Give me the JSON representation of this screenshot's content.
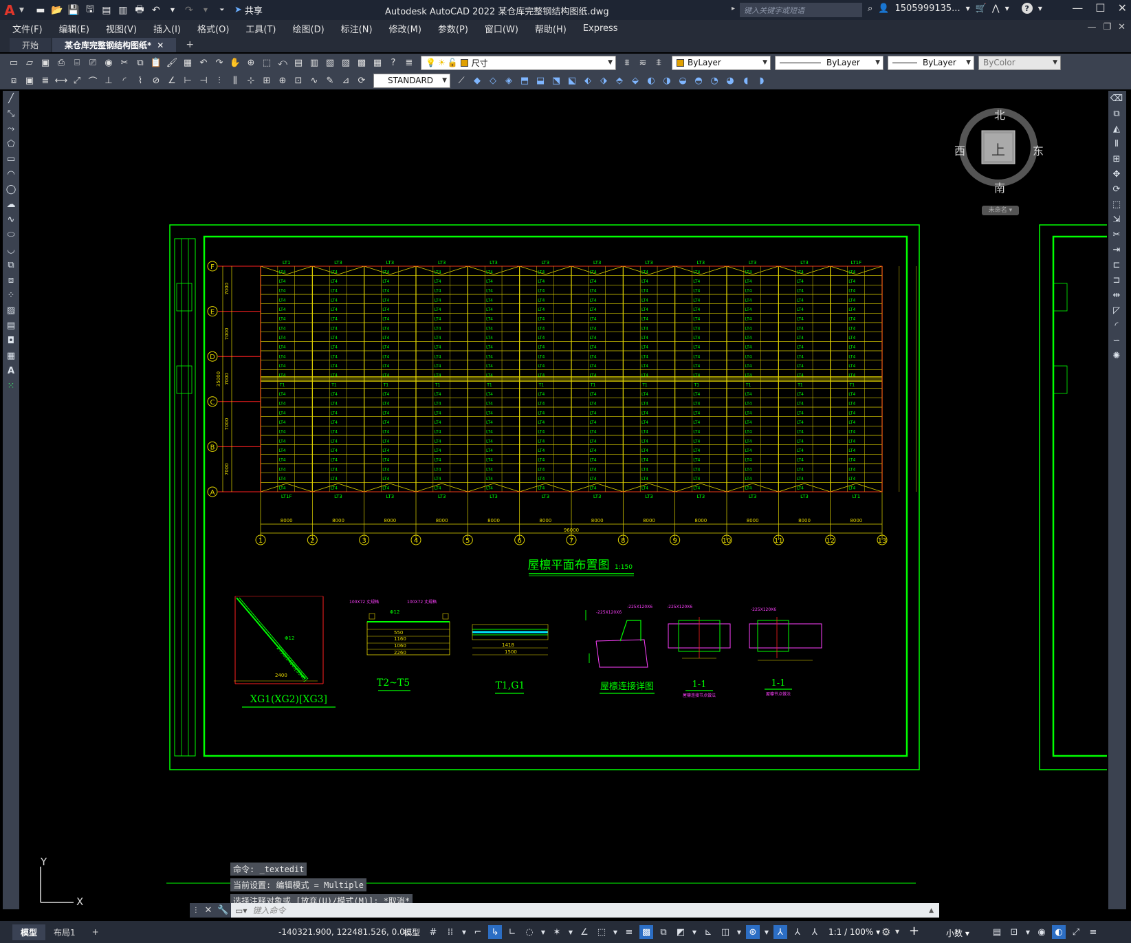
{
  "app": {
    "title": "Autodesk AutoCAD 2022    某仓库完整钢结构图纸.dwg",
    "logo": "A",
    "share_label": "共享",
    "search_placeholder": "键入关键字或短语",
    "user": "1505999135...",
    "help": "?"
  },
  "menu": [
    "文件(F)",
    "编辑(E)",
    "视图(V)",
    "插入(I)",
    "格式(O)",
    "工具(T)",
    "绘图(D)",
    "标注(N)",
    "修改(M)",
    "参数(P)",
    "窗口(W)",
    "帮助(H)",
    "Express"
  ],
  "tabs": [
    {
      "label": "开始",
      "active": false
    },
    {
      "label": "某仓库完整钢结构图纸*",
      "active": true
    }
  ],
  "toolbar": {
    "layer_name": "尺寸",
    "color_select": "ByLayer",
    "linetype_select": "ByLayer",
    "lineweight_select": "ByLayer",
    "plotstyle_select": "ByColor",
    "textstyle_select": "STANDARD"
  },
  "viewcube": {
    "north": "北",
    "south": "南",
    "east": "东",
    "west": "西",
    "face": "上",
    "ucs_menu": "未命名"
  },
  "drawing": {
    "plan_title": "屋檩平面布置图",
    "plan_scale": "1:150",
    "axis_numbers": [
      "1",
      "2",
      "3",
      "4",
      "5",
      "6",
      "7",
      "8",
      "9",
      "10",
      "11",
      "12",
      "13"
    ],
    "axis_letters": [
      "F",
      "E",
      "D",
      "C",
      "B",
      "A"
    ],
    "bay_dims": [
      "8000",
      "8000",
      "8000",
      "8000",
      "8000",
      "8000",
      "8000",
      "8000",
      "8000",
      "8000",
      "8000",
      "8000"
    ],
    "total_dim": "96000",
    "row_dims": [
      "7000",
      "7000",
      "7000",
      "7000",
      "7000"
    ],
    "total_height_dim": "35000",
    "top_labels": [
      "LT1",
      "LT3",
      "LT3",
      "LT3",
      "LT3",
      "LT3",
      "LT3",
      "LT3",
      "LT3",
      "LT3",
      "LT3",
      "LT1F"
    ],
    "bottom_labels": [
      "LT1F",
      "LT3",
      "LT3",
      "LT3",
      "LT3",
      "LT3",
      "LT3",
      "LT3",
      "LT3",
      "LT3",
      "LT3",
      "LT1"
    ],
    "details": [
      {
        "title": "XG1(XG2)[XG3]",
        "note1": "2400",
        "note2": "Φ12"
      },
      {
        "title": "T2~T5",
        "note1": "100X72 丈规格",
        "dims": [
          "550",
          "1160",
          "1060",
          "2260"
        ]
      },
      {
        "title": "T1,G1",
        "dims": [
          "1418",
          "1500"
        ]
      },
      {
        "title": "屋檩连接详图",
        "note1": "-225X120X6"
      },
      {
        "title": "1-1",
        "subtitle": "屋檩连接节点做法"
      },
      {
        "title": "1-1",
        "subtitle": "屋檩节点做法"
      }
    ]
  },
  "command": {
    "history": [
      "命令: _textedit",
      "当前设置: 编辑模式 = Multiple",
      "选择注释对象或 [放弃(U)/模式(M)]: *取消*"
    ],
    "placeholder": "键入命令"
  },
  "ucs": {
    "y": "Y",
    "x": "X"
  },
  "status": {
    "tabs": [
      {
        "label": "模型",
        "active": true
      },
      {
        "label": "布局1",
        "active": false
      }
    ],
    "coordinates": "-140321.900, 122481.526, 0.0...",
    "space": "模型",
    "scale": "1:1 / 100%",
    "units": "小数"
  },
  "colors": {
    "frame": "#00ff00",
    "grid_yellow": "#e6d800",
    "red_axis": "#ff2020",
    "magenta": "#ff40ff",
    "cyan": "#00e5ff",
    "accent": "#2c6ec4"
  }
}
